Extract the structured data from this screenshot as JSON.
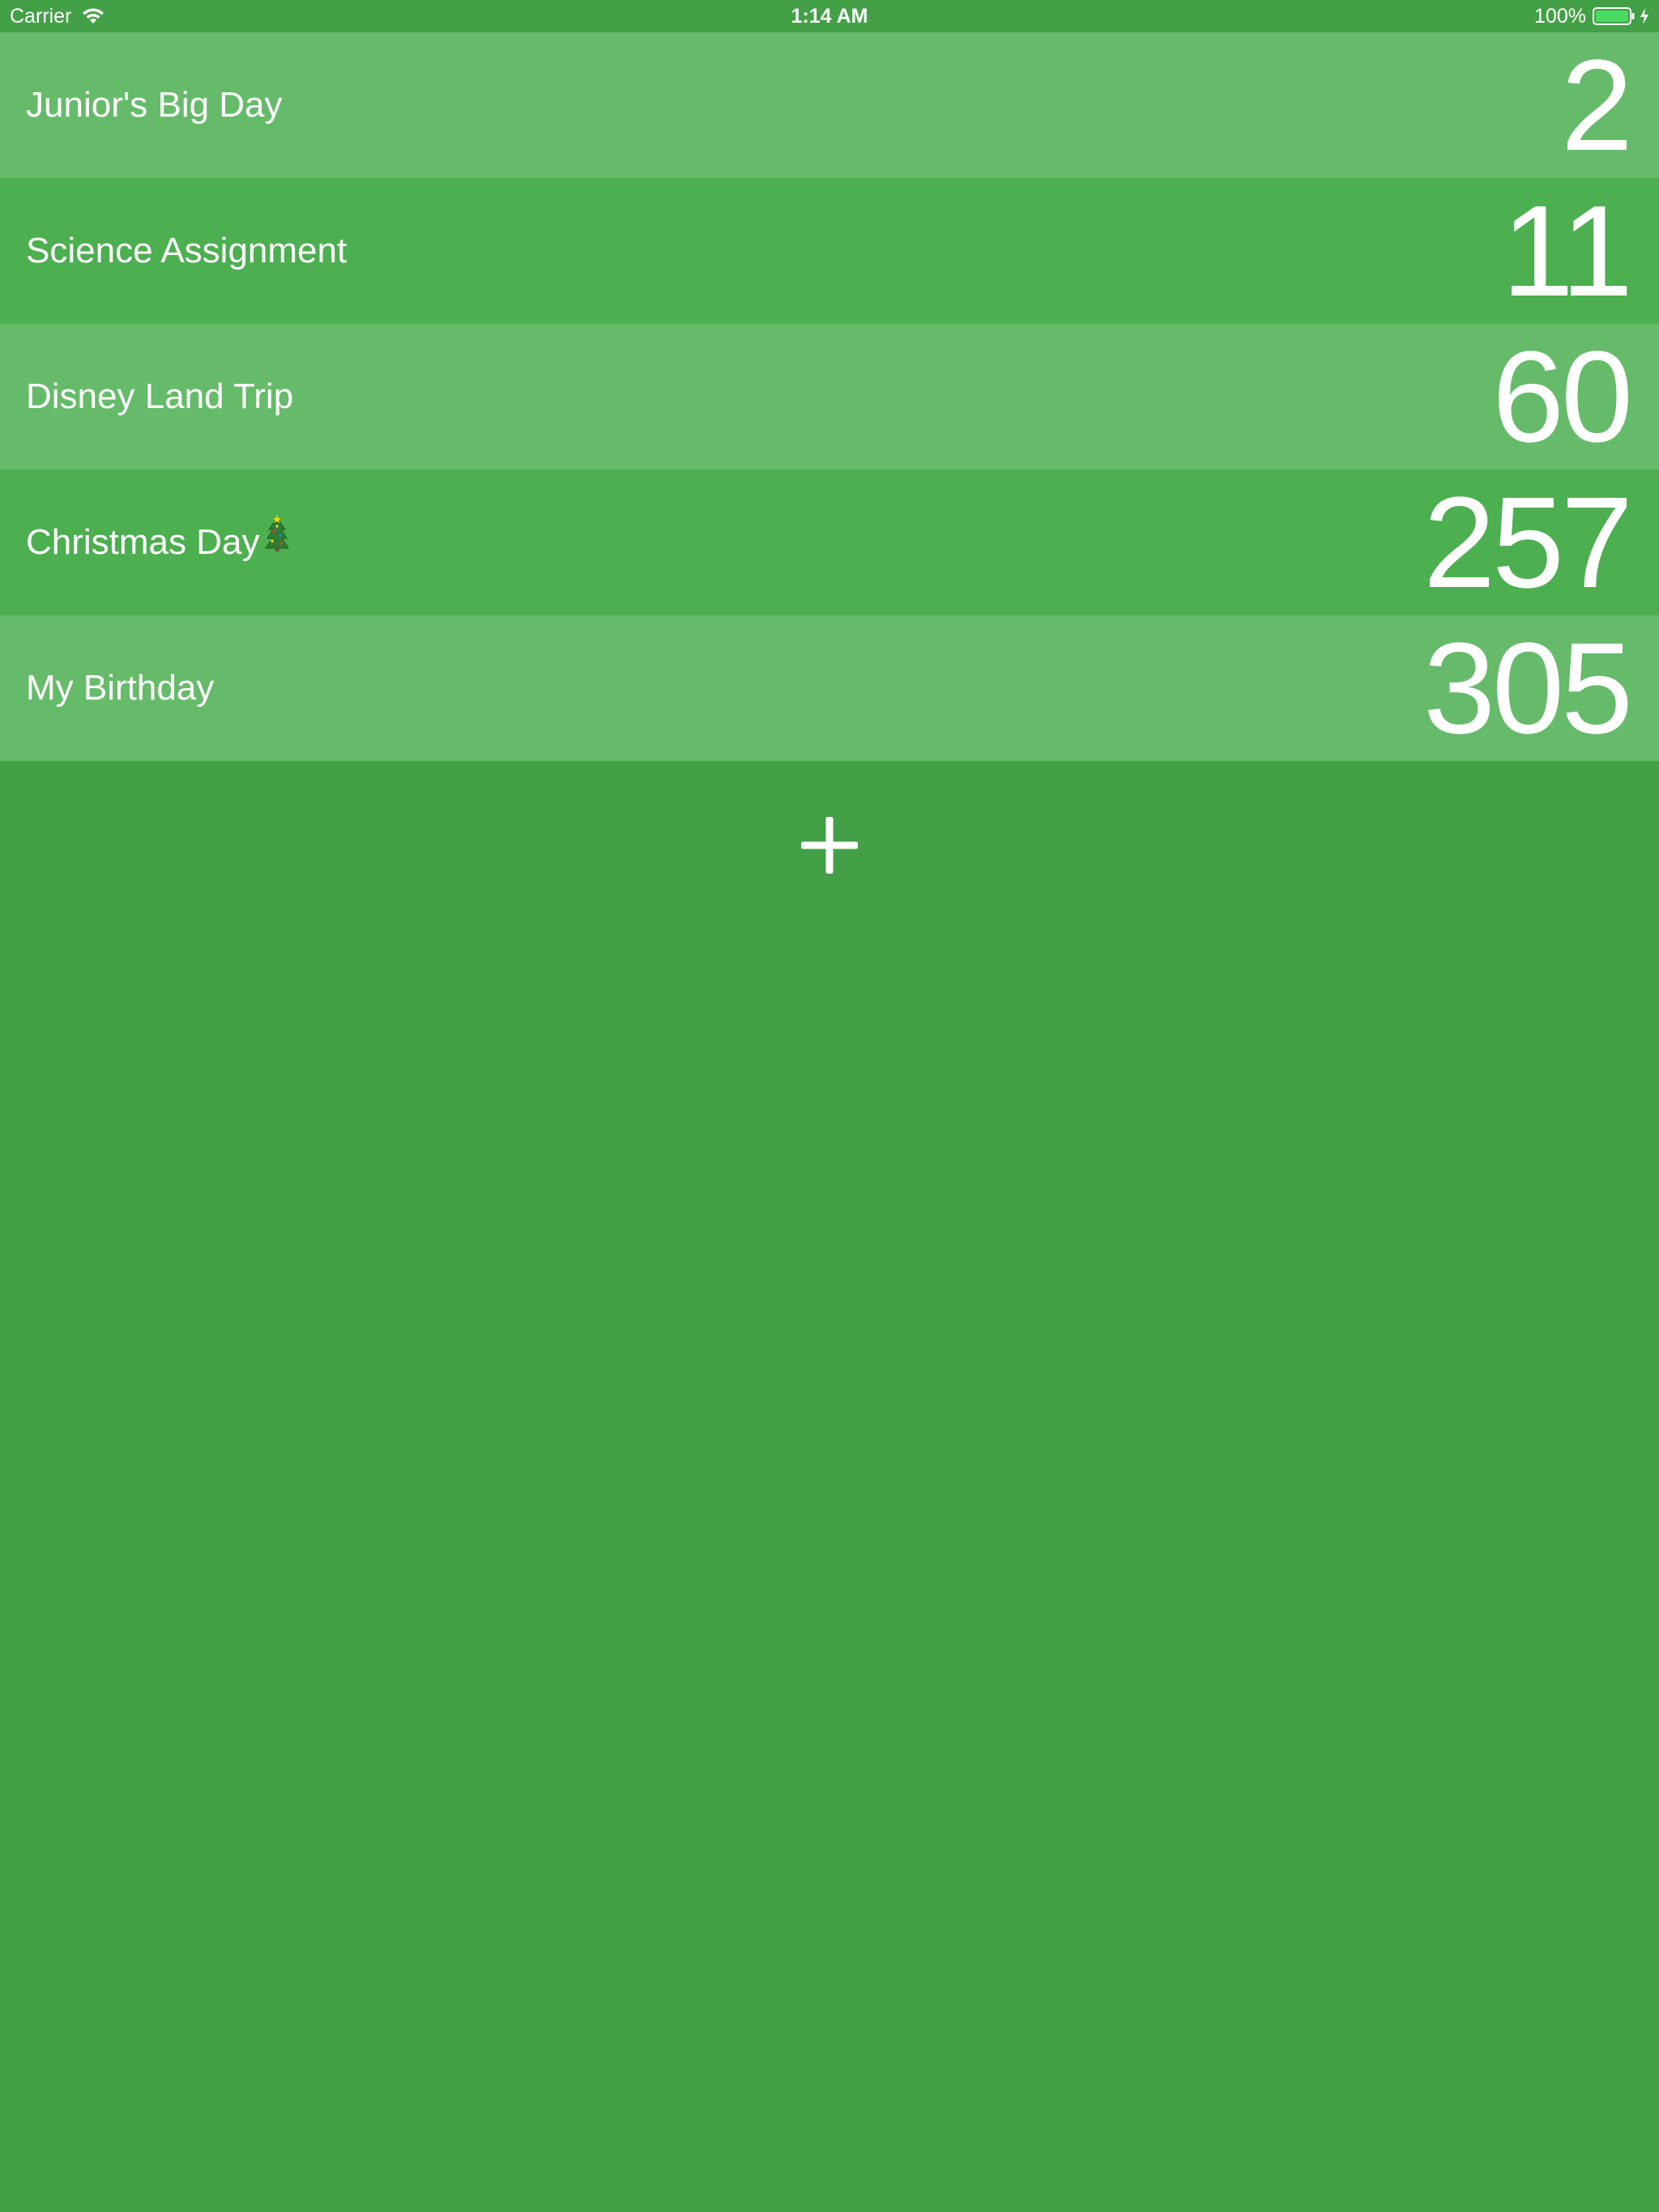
{
  "status_bar": {
    "carrier": "Carrier",
    "time": "1:14 AM",
    "battery_percent": "100%",
    "battery_level": 1.0,
    "icons": [
      "wifi-icon",
      "battery-icon",
      "charging-bolt-icon"
    ]
  },
  "colors": {
    "background": "#43a047",
    "row_light": "#66bb6a",
    "row_dark": "#4caf50",
    "text": "#ffffff"
  },
  "events": [
    {
      "title": "Junior's Big Day",
      "days": "2"
    },
    {
      "title": "Science Assignment",
      "days": "11"
    },
    {
      "title": "Disney Land Trip",
      "days": "60"
    },
    {
      "title": "Christmas Day",
      "days": "257",
      "icon": "christmas-tree-icon"
    },
    {
      "title": "My Birthday",
      "days": "305"
    }
  ],
  "add_button": {
    "icon": "plus-icon"
  }
}
